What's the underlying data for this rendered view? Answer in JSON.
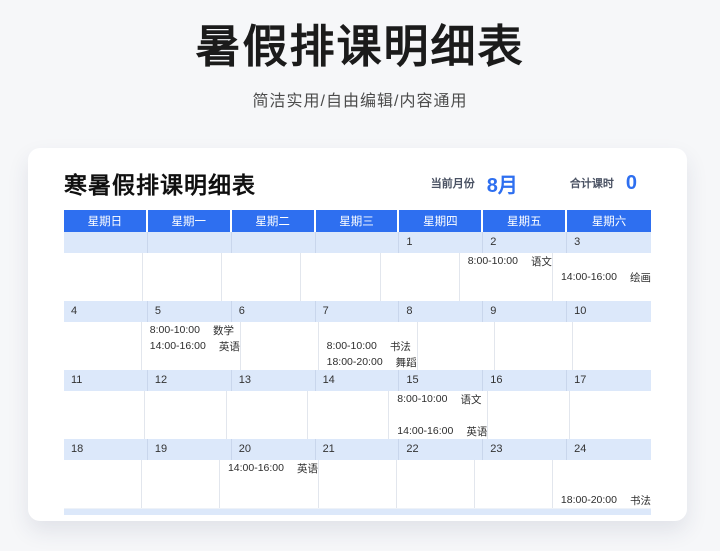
{
  "colors": {
    "accent_blue": "#2e6ff0",
    "header_blue": "#2e6ff0",
    "date_row_blue": "#dce8fa",
    "page_background": "#f6f7f9"
  },
  "hero": {
    "title": "暑假排课明细表",
    "subtitle": "简洁实用/自由编辑/内容通用"
  },
  "card": {
    "title": "寒暑假排课明细表",
    "current_month": {
      "label": "当前月份",
      "value": "8月"
    },
    "total_hours": {
      "label": "合计课时",
      "value": "0"
    }
  },
  "calendar": {
    "weekday_headers": [
      "星期日",
      "星期一",
      "星期二",
      "星期三",
      "星期四",
      "星期五",
      "星期六"
    ],
    "weeks": [
      {
        "dates": [
          "",
          "",
          "",
          "",
          "1",
          "2",
          "3"
        ],
        "entries": [
          {
            "col": 5,
            "slot": 0,
            "time": "8:00-10:00",
            "subject": "语文"
          },
          {
            "col": 6,
            "slot": 1,
            "time": "14:00-16:00",
            "subject": "绘画"
          }
        ]
      },
      {
        "dates": [
          "4",
          "5",
          "6",
          "7",
          "8",
          "9",
          "10"
        ],
        "entries": [
          {
            "col": 1,
            "slot": 0,
            "time": "8:00-10:00",
            "subject": "数学"
          },
          {
            "col": 1,
            "slot": 1,
            "time": "14:00-16:00",
            "subject": "英语"
          },
          {
            "col": 3,
            "slot": 1,
            "time": "8:00-10:00",
            "subject": "书法"
          },
          {
            "col": 3,
            "slot": 2,
            "time": "18:00-20:00",
            "subject": "舞蹈"
          }
        ]
      },
      {
        "dates": [
          "11",
          "12",
          "13",
          "14",
          "15",
          "16",
          "17"
        ],
        "entries": [
          {
            "col": 4,
            "slot": 0,
            "time": "8:00-10:00",
            "subject": "语文"
          },
          {
            "col": 4,
            "slot": 2,
            "time": "14:00-16:00",
            "subject": "英语"
          }
        ]
      },
      {
        "dates": [
          "18",
          "19",
          "20",
          "21",
          "22",
          "23",
          "24"
        ],
        "entries": [
          {
            "col": 2,
            "slot": 0,
            "time": "14:00-16:00",
            "subject": "英语"
          },
          {
            "col": 6,
            "slot": 2,
            "time": "18:00-20:00",
            "subject": "书法"
          }
        ]
      }
    ]
  }
}
